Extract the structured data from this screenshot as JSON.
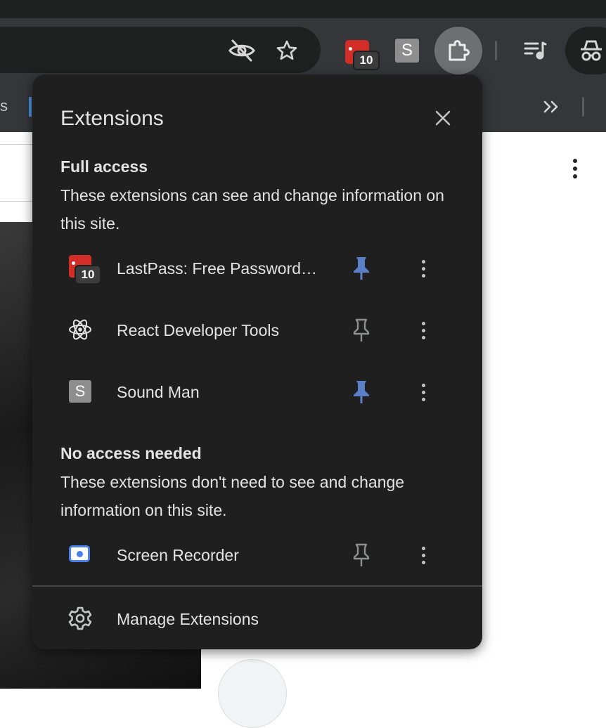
{
  "browser": {
    "tab_fragment": "s",
    "badge_count": "10",
    "soundman_letter": "S"
  },
  "popup": {
    "title": "Extensions",
    "full_access": {
      "heading": "Full access",
      "description": "These extensions can see and change information on this site.",
      "items": [
        {
          "name": "LastPass: Free Password…",
          "icon": "lastpass-icon",
          "badge": "10",
          "pinned": true
        },
        {
          "name": "React Developer Tools",
          "icon": "react-icon",
          "pinned": false
        },
        {
          "name": "Sound Man",
          "icon": "soundman-icon",
          "letter": "S",
          "pinned": true
        }
      ]
    },
    "no_access": {
      "heading": "No access needed",
      "description": "These extensions don't need to see and change information on this site.",
      "items": [
        {
          "name": "Screen Recorder",
          "icon": "screen-recorder-icon",
          "pinned": false
        }
      ]
    },
    "manage_label": "Manage Extensions"
  },
  "colors": {
    "pinned": "#5b7fc7",
    "unpinned": "#8e918f",
    "lastpass": "#d32d27"
  }
}
